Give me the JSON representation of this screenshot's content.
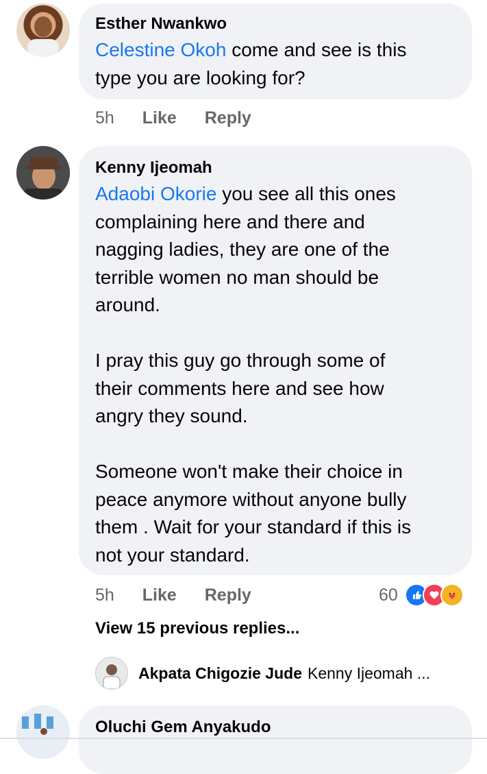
{
  "comments": [
    {
      "author": "Esther Nwankwo",
      "mention": "Celestine Okoh",
      "text_lines": [
        "come and see is this",
        "type you are looking for?"
      ],
      "time": "5h",
      "like": "Like",
      "reply": "Reply"
    },
    {
      "author": "Kenny Ijeomah",
      "mention": "Adaobi Okorie",
      "first_line_rest": " you see all this ones",
      "para1_lines": [
        "complaining here and there and",
        "nagging ladies, they are one of the",
        "terrible women no man should be",
        "around."
      ],
      "para2_lines": [
        "I pray this guy go through some of",
        "their comments here and see how",
        "angry they sound."
      ],
      "para3_lines": [
        "Someone won't make their choice in",
        "peace anymore without anyone bully",
        "them . Wait for your standard if this is",
        "not your standard."
      ],
      "time": "5h",
      "like": "Like",
      "reply": "Reply",
      "reaction_count": "60",
      "reaction_icons": [
        "like-icon",
        "love-icon",
        "care-icon"
      ],
      "view_replies": "View 15 previous replies...",
      "latest_reply": {
        "author": "Akpata Chigozie Jude",
        "preview": "Kenny Ijeomah ..."
      }
    },
    {
      "author": "Oluchi Gem Anyakudo"
    }
  ],
  "colors": {
    "bubble": "#f0f2f5",
    "mention": "#1877f2",
    "meta": "#65676b",
    "like_blue": "#1877f2",
    "love_red": "#f33e58",
    "care_yellow": "#f7b125"
  }
}
